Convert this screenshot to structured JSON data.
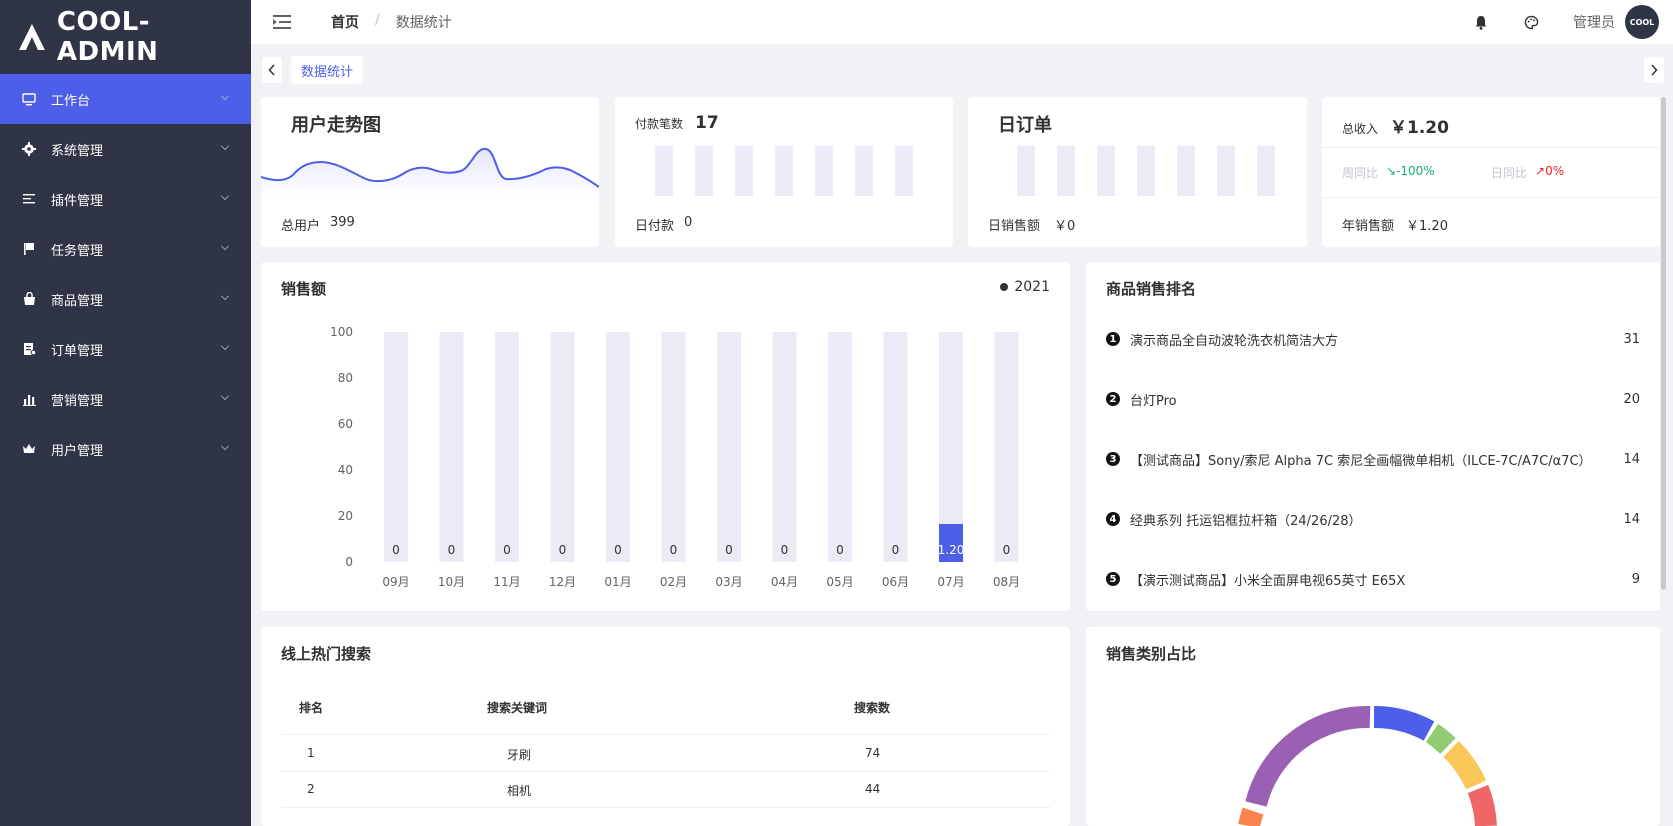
{
  "app": {
    "name": "COOL-ADMIN"
  },
  "sidebar": {
    "items": [
      {
        "label": "工作台",
        "icon": "monitor-icon"
      },
      {
        "label": "系统管理",
        "icon": "gear-icon"
      },
      {
        "label": "插件管理",
        "icon": "list-icon"
      },
      {
        "label": "任务管理",
        "icon": "flag-icon"
      },
      {
        "label": "商品管理",
        "icon": "bag-icon"
      },
      {
        "label": "订单管理",
        "icon": "order-icon"
      },
      {
        "label": "营销管理",
        "icon": "bar-chart-icon"
      },
      {
        "label": "用户管理",
        "icon": "crown-icon"
      }
    ]
  },
  "header": {
    "breadcrumb": [
      "首页",
      "/",
      "数据统计"
    ],
    "username": "管理员",
    "avatar_text": "COOL"
  },
  "tabs": {
    "active": "数据统计"
  },
  "stats": {
    "user_trend": {
      "title": "用户走势图",
      "footer_label": "总用户",
      "footer_value": "399"
    },
    "payments": {
      "label": "付款笔数",
      "value": "17",
      "footer_label": "日付款",
      "footer_value": "0",
      "bar_count": 7
    },
    "daily_orders": {
      "title": "日订单",
      "footer_label": "日销售额",
      "footer_value": "￥0",
      "bar_count": 7
    },
    "revenue": {
      "label": "总收入",
      "value": "￥1.20",
      "week_label": "周同比",
      "week_value": "↘-100%",
      "week_color": "#13b26f",
      "day_label": "日同比",
      "day_value": "↗0%",
      "day_color": "#f5222d",
      "footer_label": "年销售额",
      "footer_value": "￥1.20"
    }
  },
  "sales": {
    "title": "销售额",
    "legend": "2021",
    "accent": "#4d5ee8",
    "track": "#ebebf6"
  },
  "chart_data": {
    "type": "bar",
    "title": "销售额",
    "categories": [
      "09月",
      "10月",
      "11月",
      "12月",
      "01月",
      "02月",
      "03月",
      "04月",
      "05月",
      "06月",
      "07月",
      "08月"
    ],
    "values": [
      0,
      0,
      0,
      0,
      0,
      0,
      0,
      0,
      0,
      0,
      1.2,
      0
    ],
    "value_labels": [
      "0",
      "0",
      "0",
      "0",
      "0",
      "0",
      "0",
      "0",
      "0",
      "0",
      "1.20",
      "0"
    ],
    "yticks": [
      "100",
      "80",
      "60",
      "40",
      "20",
      "0"
    ],
    "ylim": [
      0,
      100
    ],
    "legend": "2021"
  },
  "ranking": {
    "title": "商品销售排名",
    "items": [
      {
        "badge": "1",
        "name": "演示商品全自动波轮洗衣机简洁大方",
        "count": "31"
      },
      {
        "badge": "2",
        "name": "台灯Pro",
        "count": "20"
      },
      {
        "badge": "3",
        "name": "【测试商品】Sony/索尼 Alpha 7C 索尼全画幅微单相机（ILCE-7C/A7C/α7C）",
        "count": "14"
      },
      {
        "badge": "4",
        "name": "经典系列 托运铝框拉杆箱（24/26/28）",
        "count": "14"
      },
      {
        "badge": "5",
        "name": "【演示测试商品】小米全面屏电视65英寸 E65X",
        "count": "9"
      }
    ]
  },
  "hot_search": {
    "title": "线上热门搜索",
    "headers": [
      "排名",
      "搜索关键词",
      "搜索数"
    ],
    "rows": [
      [
        "1",
        "牙刷",
        "74"
      ],
      [
        "2",
        "相机",
        "44"
      ]
    ]
  },
  "category": {
    "title": "销售类别占比",
    "colors": [
      "#4d5ee8",
      "#91cc75",
      "#fac858",
      "#ee6666",
      "#fc8452",
      "#9a60b4"
    ]
  }
}
